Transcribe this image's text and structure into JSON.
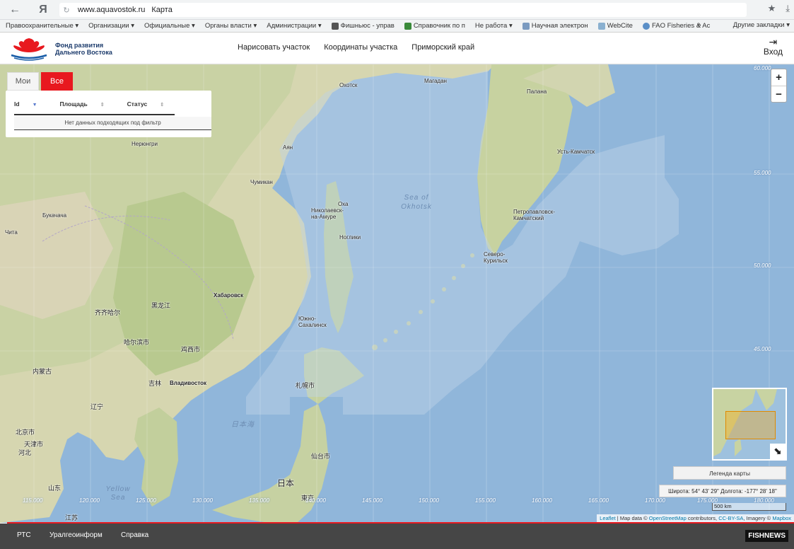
{
  "browser": {
    "url": "www.aquavostok.ru",
    "page_title": "Карта",
    "yandex": "Я"
  },
  "bookmarks": {
    "items": [
      "Правоохранительные ▾",
      "Организации ▾",
      "Официальные ▾",
      "Органы власти ▾",
      "Администрации ▾",
      "Фишньюс - управ",
      "Справочник по п",
      "Не работа ▾",
      "Научная электрон",
      "WebCite",
      "FAO Fisheries & Ac"
    ],
    "more": "»",
    "other": "Другие закладки ▾"
  },
  "header": {
    "logo_line1": "Фонд развития",
    "logo_line2": "Дальнего Востока",
    "menu": [
      "Нарисовать участок",
      "Координаты участка",
      "Приморский край"
    ],
    "login": "Вход"
  },
  "filter": {
    "tab_mine": "Мои",
    "tab_all": "Все",
    "col_id": "Id",
    "col_area": "Площадь",
    "col_status": "Статус",
    "empty": "Нет данных подходящих под фильтр"
  },
  "map": {
    "zoom_in": "+",
    "zoom_out": "−",
    "places": [
      "Охотск",
      "Магадан",
      "Палана",
      "Нерюнгри",
      "Аян",
      "Усть-Камчатск",
      "Чумикан",
      "Оха",
      "Николаевск-на-Амуре",
      "Ноглики",
      "Букачача",
      "Петропавловск-Камчатский",
      "Чита",
      "Северо-Курильск",
      "Хабаровск",
      "黑龙江",
      "齐齐哈尔",
      "Южно-Сахалинск",
      "哈尔滨市",
      "鸡西市",
      "内蒙古",
      "吉林",
      "Владивосток",
      "札幌市",
      "辽宁",
      "北京市",
      "天津市",
      "河北",
      "仙台市",
      "日本",
      "山东",
      "江苏",
      "東京"
    ],
    "sea_okhotsk": "Sea of Okhotsk",
    "sea_japan": "日本海",
    "yellow_sea": "Yellow Sea",
    "lat_labels": [
      "60.000",
      "55.000",
      "50.000",
      "45.000"
    ],
    "lon_labels": [
      "115.000",
      "120.000",
      "125.000",
      "130.000",
      "135.000",
      "140.000",
      "145.000",
      "150.000",
      "155.000",
      "160.000",
      "165.000",
      "170.000",
      "175.000",
      "180.000"
    ],
    "legend": "Легенда карты",
    "coords": "Широта: 54° 43' 29\" Долгота: -177° 28' 18\"",
    "scale": "500 km",
    "attr_leaflet": "Leaflet",
    "attr_text1": " | Map data © ",
    "attr_osm": "OpenStreetMap",
    "attr_text2": " contributors, ",
    "attr_cc": "CC-BY-SA",
    "attr_text3": ", Imagery © ",
    "attr_mapbox": "Mapbox"
  },
  "footer": {
    "links": [
      "РТС",
      "Уралгеоинформ",
      "Справка"
    ],
    "brand": "FISHNEWS"
  }
}
